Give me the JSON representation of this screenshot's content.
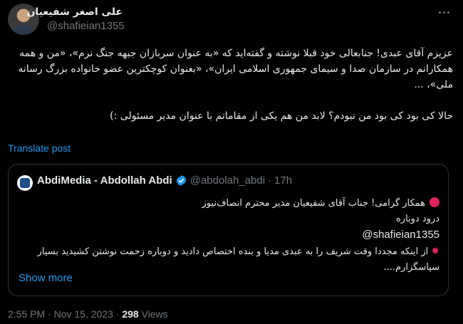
{
  "author": {
    "name": "علی اصغر شفیعیان",
    "handle": "@shafieian1355"
  },
  "tweet": {
    "text_para1": "عزیزم آقای عبدی! جنابعالی خود قبلا نوشته و گفته‌اید که «به عنوان سربازان جبهه جنگ نرم»، «من و همه همکارانم در سازمان صدا و سیمای جمهوری اسلامی ایران»، «بعنوان کوچکترین عضو خانواده بزرگ رسانه ملی»، ...",
    "text_para2": "حالا کی بود کی بود من نبودم؟ لابد من هم یکی از مقاماتم با عنوان مدیر مسئولی :)",
    "translate_label": "Translate post"
  },
  "quote": {
    "name": "AbdiMedia - Abdollah Abdi",
    "handle": "@abdolah_abdi",
    "separator": "·",
    "time": "17h",
    "line1": "همکار گرامی! جناب آقای شفیعیان مدیر محترم انصاف‌نیوز",
    "line2": "درود دوباره",
    "mention": "@shafieian1355",
    "line4": "از اینکه مجددا وقت شریف را به عبدی مدیا و بنده اختصاص دادید و دوباره زحمت نوشتن کشیدید بسیار",
    "line5": "سپاسگزارم....",
    "show_more": "Show more",
    "verified_color": "#1d9bf0"
  },
  "meta": {
    "time": "2:55 PM",
    "separator": "·",
    "date": "Nov 15, 2023",
    "views_count": "298",
    "views_label": "Views"
  },
  "icons": {
    "more": "more-dots-icon",
    "verified": "verified-badge-icon",
    "red_circle": "red-circle-icon",
    "anger": "anger-symbol-icon"
  }
}
